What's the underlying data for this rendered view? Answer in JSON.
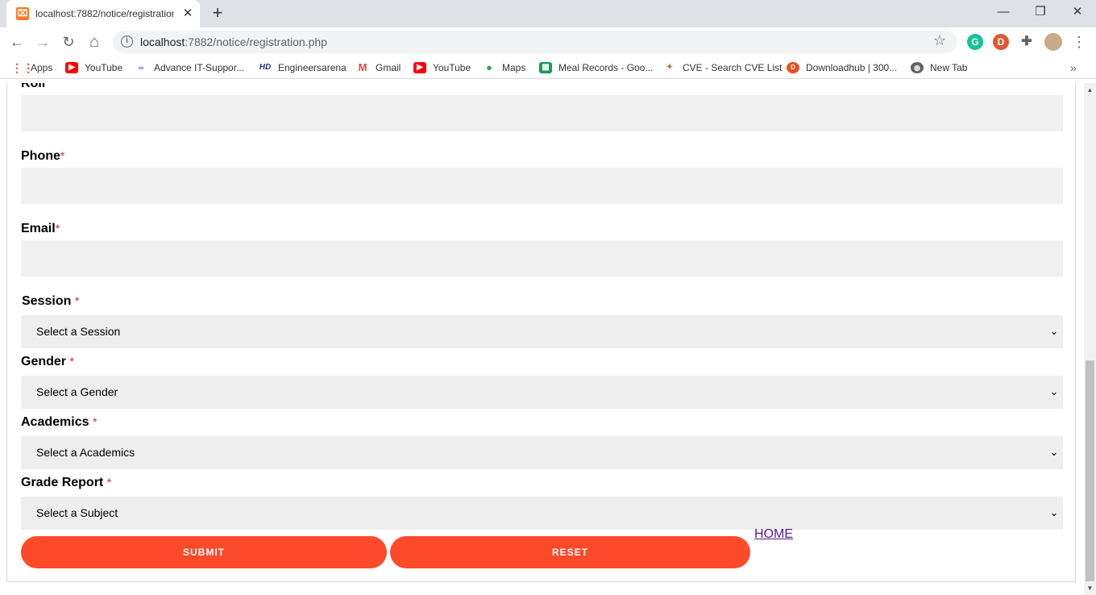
{
  "browser": {
    "tab_title": "localhost:7882/notice/registration.php",
    "tab_favicon": "⌧",
    "close_tab": "✕",
    "new_tab": "+",
    "minimize": "—",
    "restore": "❐",
    "close_window": "✕",
    "url_host": "localhost",
    "url_rest": ":7882/notice/registration.php",
    "back": "←",
    "forward": "→",
    "reload": "↻",
    "home": "⌂",
    "star": "☆",
    "ext_grammarly": "G",
    "ext_duckduckgo": "D",
    "ext_puzzle": "✚",
    "menu": "⋮"
  },
  "bookmarks": [
    {
      "label": "Apps",
      "icon": "apps-grid-icon",
      "color": "#ea4335"
    },
    {
      "label": "YouTube",
      "icon": "youtube-icon",
      "color": "#ff0000"
    },
    {
      "label": "Advance IT-Suppor...",
      "icon": "advance-it-icon",
      "color": "#4a6fd1"
    },
    {
      "label": "Engineersarena",
      "icon": "hd-icon",
      "color": "#1a3a7a"
    },
    {
      "label": "Gmail",
      "icon": "gmail-icon",
      "color": "#ea4335"
    },
    {
      "label": "YouTube",
      "icon": "youtube-icon",
      "color": "#ff0000"
    },
    {
      "label": "Maps",
      "icon": "maps-icon",
      "color": "#34a853"
    },
    {
      "label": "Meal Records - Goo...",
      "icon": "sheets-icon",
      "color": "#0f9d58"
    },
    {
      "label": "CVE - Search CVE List",
      "icon": "cve-icon",
      "color": "#a07a2a"
    },
    {
      "label": "Downloadhub | 300...",
      "icon": "downloadhub-icon",
      "color": "#e8501e"
    },
    {
      "label": "New Tab",
      "icon": "globe-icon",
      "color": "#5f6368"
    }
  ],
  "bookmarks_more": "»",
  "form": {
    "roll_label": "Roll",
    "phone_label": "Phone",
    "email_label": "Email",
    "session_label": "Session",
    "gender_label": "Gender",
    "academics_label": "Academics",
    "grade_label": "Grade Report",
    "required_mark": "*",
    "session_placeholder": "Select a Session",
    "gender_placeholder": "Select a Gender",
    "academics_placeholder": "Select a Academics",
    "grade_placeholder": "Select a Subject",
    "submit_label": "SUBMIT",
    "reset_label": "RESET",
    "home_link": "HOME",
    "chevron": "⌄"
  },
  "colors": {
    "accent_button": "#fd4a2a",
    "required": "#e3241b",
    "input_bg": "#f0f0f0"
  }
}
